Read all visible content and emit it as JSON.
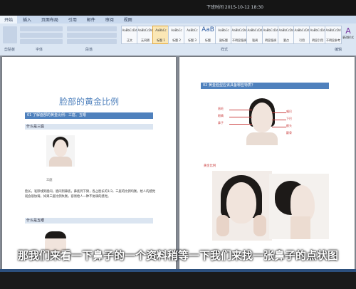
{
  "window": {
    "camera_overlay": "下班时间 2015-10-12 18:30"
  },
  "ribbon": {
    "tabs": [
      "开始",
      "插入",
      "页面布局",
      "引用",
      "邮件",
      "审阅",
      "视图"
    ],
    "group_labels": [
      "剪贴板",
      "字体",
      "段落",
      "样式",
      "编辑"
    ],
    "styles": [
      {
        "preview": "AaBbCcDd",
        "name": "正文"
      },
      {
        "preview": "AaBbCcDd",
        "name": "无间隔"
      },
      {
        "preview": "AaBbCc",
        "name": "标题 1",
        "selected": true
      },
      {
        "preview": "AaBbCc",
        "name": "标题 2"
      },
      {
        "preview": "AaBbCc",
        "name": "标题 3"
      },
      {
        "preview": "AaB",
        "name": "标题"
      },
      {
        "preview": "AaBbCc",
        "name": "副标题"
      },
      {
        "preview": "AaBbCcDd",
        "name": "不明显强调"
      },
      {
        "preview": "AaBbCcDd",
        "name": "强调"
      },
      {
        "preview": "AaBbCcDd",
        "name": "明显强调"
      },
      {
        "preview": "AaBbCcDd",
        "name": "要点"
      },
      {
        "preview": "AaBbCcDd",
        "name": "引用"
      },
      {
        "preview": "AaBbCcDd",
        "name": "明显引用"
      },
      {
        "preview": "AaBbCcDd",
        "name": "不明显参考"
      }
    ],
    "change_styles": "更改样式"
  },
  "page1": {
    "title": "脸部的黄金比例",
    "section1": "01 了解面部的黄金比例：三庭、五眼",
    "subhead1": "什么是三庭",
    "face_caption": "三庭",
    "para": "脸长，发际线到眉间，眉间到鼻底，鼻底到下颏，各占脸长的1/3，三庭的比例均衡，给人的感觉就会很协调，如果三庭比例失衡，容易给人一种不协调的感觉。",
    "subhead2": "什么是五眼"
  },
  "page2": {
    "section": "02 黄金脸型应该具备哪些特质？",
    "labels": [
      "眉毛",
      "眼睛",
      "鼻子",
      "嘴巴",
      "下巴",
      "额头",
      "颧骨"
    ],
    "figure_label": "黄金比例"
  },
  "subtitle": "那我们来看一下鼻子的一个资料稍等一下我们来找一张鼻子的点状图"
}
